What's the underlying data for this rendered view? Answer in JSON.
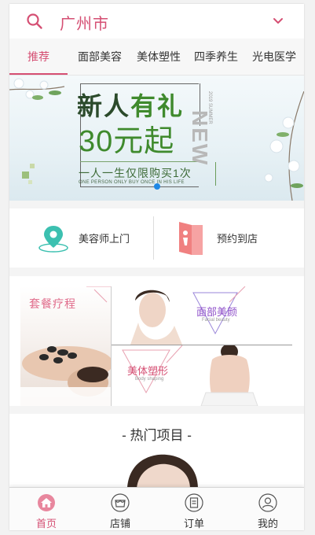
{
  "header": {
    "city": "广州市",
    "search_icon": "search-icon",
    "dropdown_icon": "chevron-down-icon"
  },
  "tabs": [
    {
      "label": "推荐",
      "active": true
    },
    {
      "label": "面部美容"
    },
    {
      "label": "美体塑性"
    },
    {
      "label": "四季养生"
    },
    {
      "label": "光电医学"
    }
  ],
  "banner": {
    "line1_a": "新人",
    "line1_b": "有礼",
    "line2": "30元起",
    "tagline": "一人一生仅限购买1次",
    "tagline_en": "ONE PERSON ONLY BUY ONCE IN HIS LIFE",
    "new_word": "NEW",
    "new_small": "2019 SUMMER"
  },
  "services": [
    {
      "label": "美容师上门",
      "icon": "location-pin-icon"
    },
    {
      "label": "预约到店",
      "icon": "store-door-icon"
    }
  ],
  "packages": {
    "left_label": "套餐疗程",
    "top_label": "面部美颜",
    "top_sub": "Facial beauty",
    "bottom_label": "美体塑形",
    "bottom_sub": "Body shaping"
  },
  "hot": {
    "heading": "- 热门项目 -"
  },
  "nav": [
    {
      "label": "首页",
      "icon": "home-icon",
      "active": true
    },
    {
      "label": "店铺",
      "icon": "shop-icon"
    },
    {
      "label": "订单",
      "icon": "order-icon"
    },
    {
      "label": "我的",
      "icon": "profile-icon"
    }
  ],
  "colors": {
    "accent": "#d54f73",
    "banner_green": "#3f8a2d",
    "dot_blue": "#1e88e5"
  }
}
